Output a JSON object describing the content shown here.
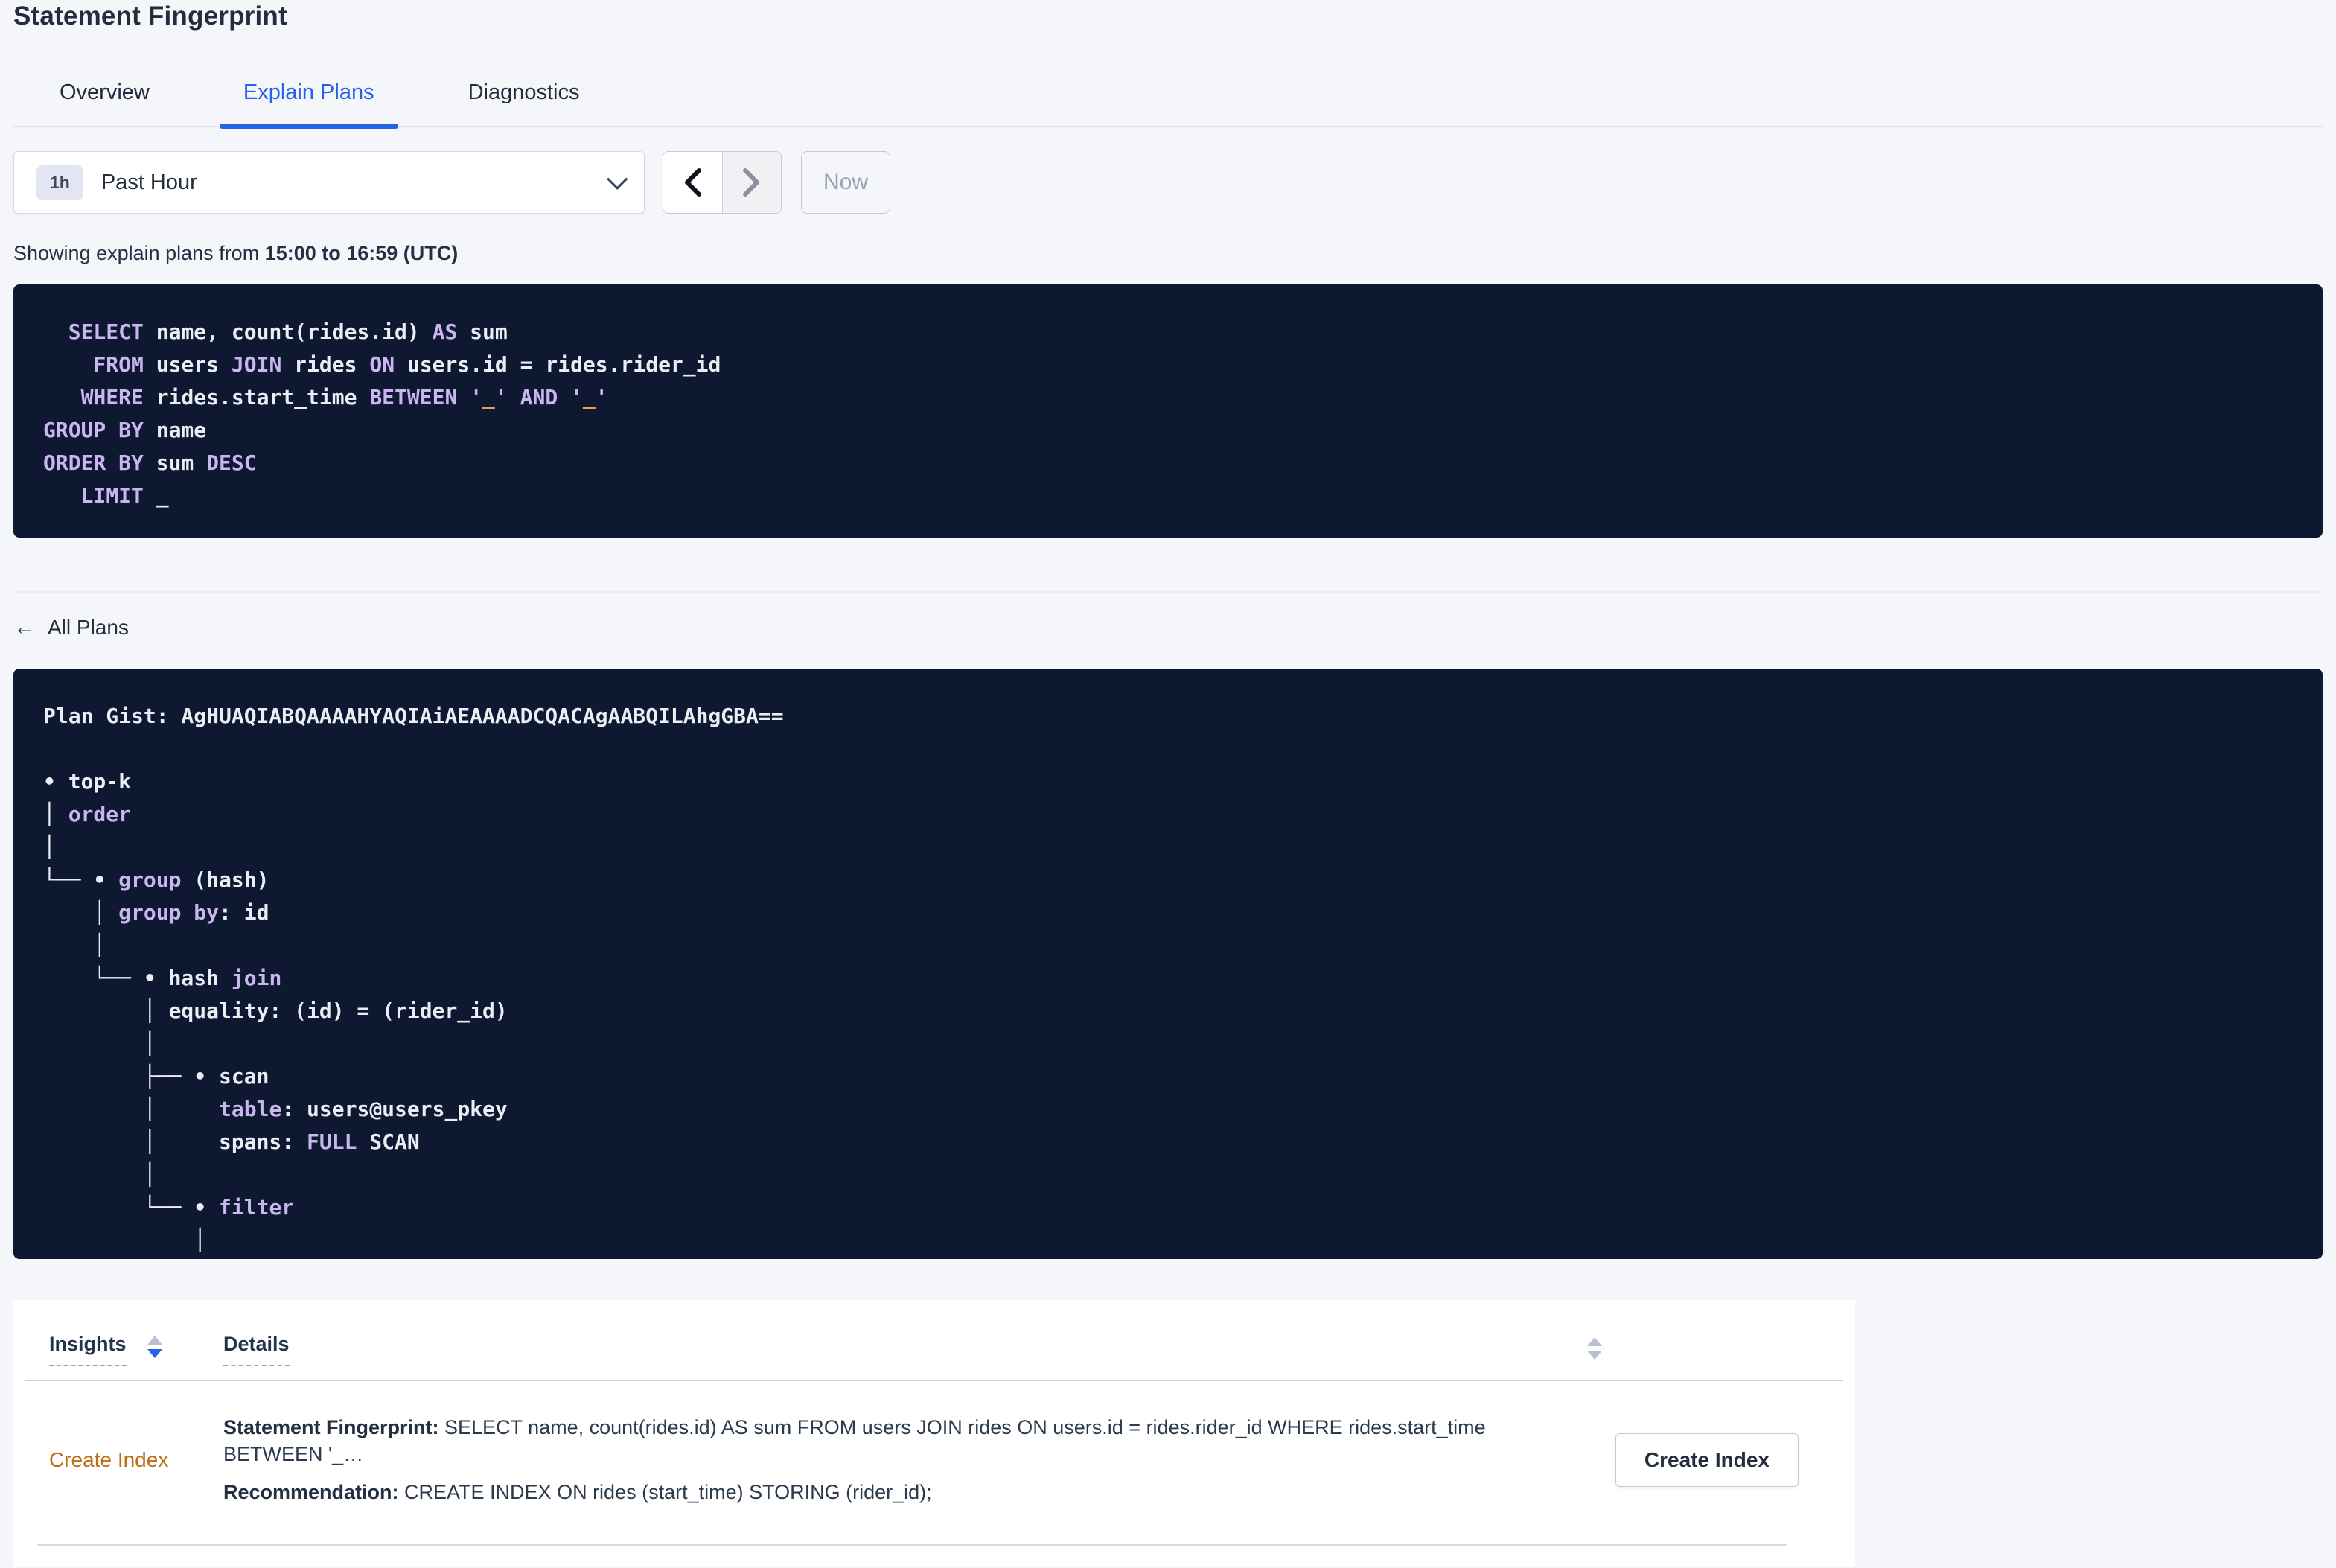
{
  "page": {
    "title": "Statement Fingerprint"
  },
  "tabs": [
    {
      "label": "Overview"
    },
    {
      "label": "Explain Plans"
    },
    {
      "label": "Diagnostics"
    }
  ],
  "toolbar": {
    "interval_badge": "1h",
    "interval_label": "Past Hour",
    "now_label": "Now"
  },
  "showing": {
    "prefix": "Showing explain plans from ",
    "range": "15:00 to 16:59 (UTC)"
  },
  "sql": {
    "lines": [
      [
        {
          "t": "  ",
          "c": "pln"
        },
        {
          "t": "SELECT",
          "c": "kw"
        },
        {
          "t": " name, count(rides.id) ",
          "c": "pln"
        },
        {
          "t": "AS",
          "c": "kw"
        },
        {
          "t": " sum",
          "c": "pln"
        }
      ],
      [
        {
          "t": "    ",
          "c": "pln"
        },
        {
          "t": "FROM",
          "c": "kw"
        },
        {
          "t": " users ",
          "c": "pln"
        },
        {
          "t": "JOIN",
          "c": "kw"
        },
        {
          "t": " rides ",
          "c": "pln"
        },
        {
          "t": "ON",
          "c": "kw"
        },
        {
          "t": " users.id = rides.rider_id",
          "c": "pln"
        }
      ],
      [
        {
          "t": "   ",
          "c": "pln"
        },
        {
          "t": "WHERE",
          "c": "kw"
        },
        {
          "t": " rides.start_time ",
          "c": "pln"
        },
        {
          "t": "BETWEEN",
          "c": "kw"
        },
        {
          "t": " ",
          "c": "pln"
        },
        {
          "t": "'",
          "c": "kw"
        },
        {
          "t": "_",
          "c": "lit"
        },
        {
          "t": "'",
          "c": "kw"
        },
        {
          "t": " ",
          "c": "pln"
        },
        {
          "t": "AND",
          "c": "kw"
        },
        {
          "t": " ",
          "c": "pln"
        },
        {
          "t": "'",
          "c": "kw"
        },
        {
          "t": "_",
          "c": "lit"
        },
        {
          "t": "'",
          "c": "kw"
        }
      ],
      [
        {
          "t": "GROUP BY",
          "c": "kw"
        },
        {
          "t": " name",
          "c": "pln"
        }
      ],
      [
        {
          "t": "ORDER BY",
          "c": "kw"
        },
        {
          "t": " sum ",
          "c": "pln"
        },
        {
          "t": "DESC",
          "c": "kw"
        }
      ],
      [
        {
          "t": "   ",
          "c": "pln"
        },
        {
          "t": "LIMIT",
          "c": "kw"
        },
        {
          "t": " _",
          "c": "pln"
        }
      ]
    ]
  },
  "back_link": {
    "arrow": "←",
    "label": "All Plans"
  },
  "gist": {
    "lines": [
      [
        {
          "t": "Plan Gist: AgHUAQIABQAAAAHYAQIAiAEAAAADCQACAgAABQILAhgGBA==",
          "c": "pln"
        }
      ],
      [],
      [
        {
          "t": "• top-k",
          "c": "pln"
        }
      ],
      [
        {
          "t": "│ ",
          "c": "pln"
        },
        {
          "t": "order",
          "c": "kw"
        }
      ],
      [
        {
          "t": "│",
          "c": "pln"
        }
      ],
      [
        {
          "t": "└── • ",
          "c": "pln"
        },
        {
          "t": "group",
          "c": "kw"
        },
        {
          "t": " (hash)",
          "c": "pln"
        }
      ],
      [
        {
          "t": "    │ ",
          "c": "pln"
        },
        {
          "t": "group by",
          "c": "kw"
        },
        {
          "t": ": id",
          "c": "pln"
        }
      ],
      [
        {
          "t": "    │",
          "c": "pln"
        }
      ],
      [
        {
          "t": "    └── • hash ",
          "c": "pln"
        },
        {
          "t": "join",
          "c": "kw"
        }
      ],
      [
        {
          "t": "        │ equality: (id) = (rider_id)",
          "c": "pln"
        }
      ],
      [
        {
          "t": "        │",
          "c": "pln"
        }
      ],
      [
        {
          "t": "        ├── • scan",
          "c": "pln"
        }
      ],
      [
        {
          "t": "        │     ",
          "c": "pln"
        },
        {
          "t": "table",
          "c": "kw"
        },
        {
          "t": ": users@users_pkey",
          "c": "pln"
        }
      ],
      [
        {
          "t": "        │     spans: ",
          "c": "pln"
        },
        {
          "t": "FULL",
          "c": "kw"
        },
        {
          "t": " SCAN",
          "c": "pln"
        }
      ],
      [
        {
          "t": "        │",
          "c": "pln"
        }
      ],
      [
        {
          "t": "        └── • ",
          "c": "pln"
        },
        {
          "t": "filter",
          "c": "kw"
        }
      ],
      [
        {
          "t": "            │",
          "c": "pln"
        }
      ]
    ]
  },
  "insights_table": {
    "columns": [
      {
        "label": "Insights"
      },
      {
        "label": "Details"
      }
    ],
    "rows": [
      {
        "insight": "Create Index",
        "fingerprint_label": "Statement Fingerprint:",
        "fingerprint_value": " SELECT name, count(rides.id) AS sum FROM users JOIN rides ON users.id = rides.rider_id WHERE rides.start_time BETWEEN '_…",
        "recommendation_label": "Recommendation:",
        "recommendation_value": " CREATE INDEX ON rides (start_time) STORING (rider_id);",
        "action_label": "Create Index"
      }
    ]
  },
  "colors": {
    "accent_blue": "#2563eb",
    "insight_orange": "#bf6d13",
    "code_background": "#0e1830",
    "code_keyword": "#c9b5ef",
    "code_plain": "#e9edf4",
    "code_literal": "#efa04a"
  }
}
